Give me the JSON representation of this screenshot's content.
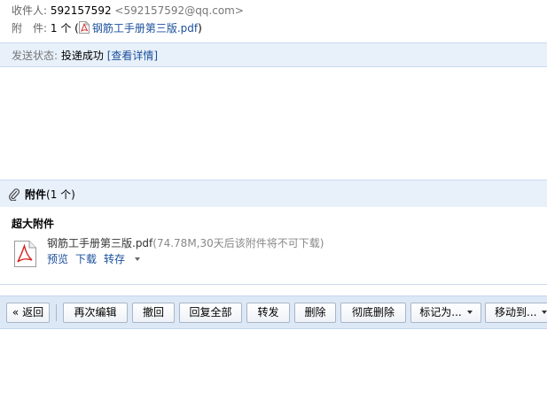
{
  "header": {
    "recipient_label": "收件人:",
    "recipient_name": "592157592",
    "recipient_email": "<592157592@qq.com>",
    "attachment_label": "附　件:",
    "attachment_count": "1 个 (",
    "attachment_file": "钢筋工手册第三版.pdf",
    "attachment_close": ")"
  },
  "status": {
    "label": "发送状态:",
    "value": "投递成功",
    "details_link": "[查看详情]"
  },
  "attachments": {
    "title": "附件",
    "count": "(1 个)",
    "section_label": "超大附件",
    "file": {
      "name": "钢筋工手册第三版.pdf",
      "meta": "(74.78M,30天后该附件将不可下载)",
      "actions": {
        "preview": "预览",
        "download": "下载",
        "save": "转存"
      }
    }
  },
  "toolbar": {
    "back": "« 返回",
    "reedit": "再次编辑",
    "recall": "撤回",
    "reply_all": "回复全部",
    "forward": "转发",
    "delete": "删除",
    "delete_permanent": "彻底删除",
    "mark_as": "标记为...",
    "move_to": "移动到..."
  },
  "colors": {
    "link": "#1b4f9c",
    "panel": "#e8f0fa",
    "toolbar": "#dde8f6"
  }
}
